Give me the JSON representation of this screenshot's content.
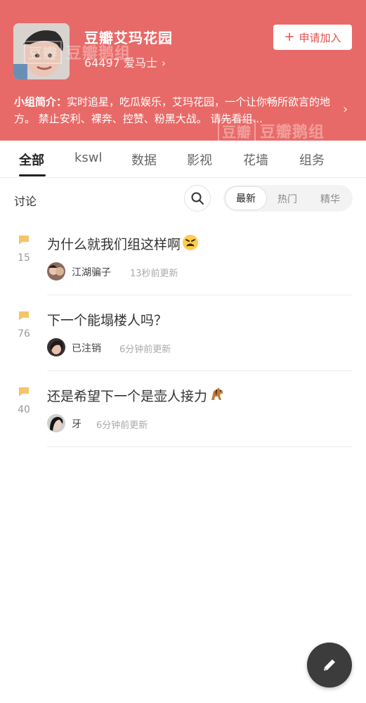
{
  "header": {
    "title": "豆瓣艾玛花园",
    "member_count": "64497 爱马士",
    "member_arrow": "›",
    "join_plus": "+",
    "join_label": "申请加入",
    "intro_label": "小组简介：",
    "intro_text": "实时追星，吃瓜娱乐，艾玛花园，一个让你畅所欲言的地方。 禁止安利、裸奔、控赞、粉黑大战。 请先看组...",
    "intro_arrow": "›",
    "bg_color": "#e86a68"
  },
  "watermarks": {
    "top_box": "豆瓣",
    "top_text": "豆瓣鹅组",
    "bottom_box": "豆瓣",
    "bottom_text": "豆瓣鹅组"
  },
  "tabs": [
    {
      "label": "全部",
      "active": true
    },
    {
      "label": "kswl",
      "active": false
    },
    {
      "label": "数据",
      "active": false
    },
    {
      "label": "影视",
      "active": false
    },
    {
      "label": "花墙",
      "active": false
    },
    {
      "label": "组务",
      "active": false
    }
  ],
  "filter": {
    "section_label": "讨论",
    "sort_options": [
      {
        "label": "最新",
        "active": true
      },
      {
        "label": "热门",
        "active": false
      },
      {
        "label": "精华",
        "active": false
      }
    ]
  },
  "posts": [
    {
      "count": "15",
      "title": "为什么就我们组这样啊",
      "emoji": "angry-face-icon",
      "author": "江湖骗子",
      "time": "13秒前更新"
    },
    {
      "count": "76",
      "title": "下一个能塌楼人吗？",
      "emoji": "",
      "author": "已注销",
      "time": "6分钟前更新"
    },
    {
      "count": "40",
      "title": "还是希望下一个是壶人接力",
      "emoji": "horse-icon",
      "author": "牙",
      "time": "6分钟前更新"
    }
  ],
  "colors": {
    "accent": "#e2504d",
    "bubble": "#f5c46a"
  },
  "fab": {
    "icon": "pencil-icon"
  }
}
